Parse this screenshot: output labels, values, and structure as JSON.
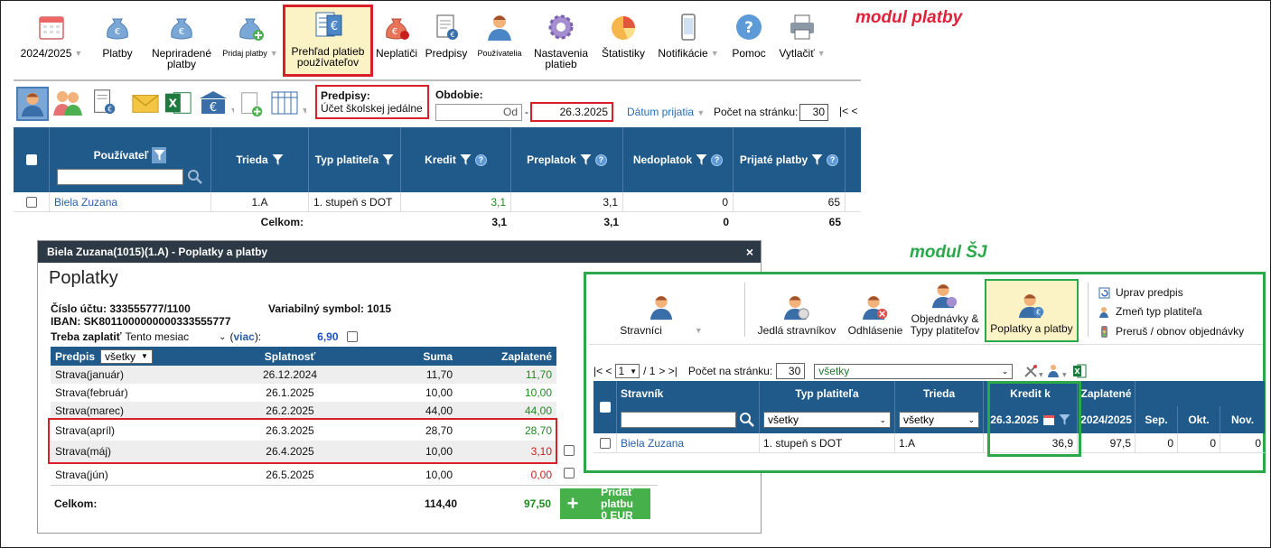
{
  "annotations": {
    "platby": "modul platby",
    "sj": "modul ŠJ"
  },
  "toolbar": {
    "items": [
      {
        "label": "2024/2025",
        "dropdown": true,
        "icon": "calendar-icon"
      },
      {
        "label": "Platby",
        "icon": "money-bag-icon"
      },
      {
        "label": "Nepriradené platby",
        "icon": "money-bag-icon"
      },
      {
        "label": "Pridaj platby",
        "dropdown": true,
        "icon": "money-bag-add-icon"
      },
      {
        "label": "Prehľad platieb používateľov",
        "active": true,
        "icon": "payments-overview-icon"
      },
      {
        "label": "Neplatiči",
        "icon": "money-bag-warning-icon"
      },
      {
        "label": "Predpisy",
        "icon": "document-euro-icon"
      },
      {
        "label": "Používatelia",
        "icon": "user-icon"
      },
      {
        "label": "Nastavenia platieb",
        "icon": "gear-icon"
      },
      {
        "label": "Štatistiky",
        "icon": "pie-chart-icon"
      },
      {
        "label": "Notifikácie",
        "dropdown": true,
        "icon": "phone-icon"
      },
      {
        "label": "Pomoc",
        "icon": "help-icon"
      },
      {
        "label": "Vytlačiť",
        "dropdown": true,
        "icon": "printer-icon"
      }
    ]
  },
  "filters": {
    "predpisy_label": "Predpisy:",
    "predpisy_value": "Účet školskej jedálne",
    "obdobie_label": "Obdobie:",
    "od_placeholder": "Od",
    "dash": "-",
    "do_value": "26.3.2025",
    "datum_prijatia": "Dátum prijatia",
    "pocet_label": "Počet na stránku:",
    "pocet_value": "30",
    "pager": "|<  <"
  },
  "top_table": {
    "headers": [
      "Používateľ",
      "Trieda",
      "Typ platiteľa",
      "Kredit",
      "Preplatok",
      "Nedoplatok",
      "Prijaté platby"
    ],
    "rows": [
      {
        "pouzivatel": "Biela Zuzana",
        "trieda": "1.A",
        "typ": "1. stupeň  s DOT",
        "kredit": "3,1",
        "preplatok": "3,1",
        "nedoplatok": "0",
        "prijate": "65"
      }
    ],
    "total": {
      "label": "Celkom:",
      "kredit": "3,1",
      "preplatok": "3,1",
      "nedoplatok": "0",
      "prijate": "65"
    }
  },
  "modal": {
    "title": "Biela Zuzana(1015)(1.A) - Poplatky a platby",
    "close": "×",
    "heading": "Poplatky",
    "cislo_uctu": "Číslo účtu: 333555777/1100",
    "variabilny": "Variabilný symbol: 1015",
    "iban": "IBAN: SK8011000000000333555777",
    "treba_label": "Treba zaplatiť",
    "treba_option": "Tento mesiac",
    "viac_open": "(",
    "viac": "viac",
    "viac_close": "):",
    "treba_amount": "6,90",
    "headers": {
      "predpis": "Predpis",
      "filter": "všetky",
      "splatnost": "Splatnosť",
      "suma": "Suma",
      "zaplatene": "Zaplatené"
    },
    "rows": [
      {
        "predpis": "Strava(január)",
        "splatnost": "26.12.2024",
        "suma": "11,70",
        "zaplatene": "11,70",
        "color": "green"
      },
      {
        "predpis": "Strava(február)",
        "splatnost": "26.1.2025",
        "suma": "10,00",
        "zaplatene": "10,00",
        "color": "green"
      },
      {
        "predpis": "Strava(marec)",
        "splatnost": "26.2.2025",
        "suma": "44,00",
        "zaplatene": "44,00",
        "color": "green"
      },
      {
        "predpis": "Strava(apríl)",
        "splatnost": "26.3.2025",
        "suma": "28,70",
        "zaplatene": "28,70",
        "color": "green"
      },
      {
        "predpis": "Strava(máj)",
        "splatnost": "26.4.2025",
        "suma": "10,00",
        "zaplatene": "3,10",
        "color": "red"
      },
      {
        "predpis": "Strava(jún)",
        "splatnost": "26.5.2025",
        "suma": "10,00",
        "zaplatene": "0,00",
        "color": "red"
      }
    ],
    "total_label": "Celkom:",
    "total_suma": "114,40",
    "total_zaplatene": "97,50",
    "add_button_line1": "Pridať platbu",
    "add_button_line2": "0 EUR"
  },
  "sj": {
    "toolbar": {
      "stravnici": "Stravníci",
      "jedla": "Jedlá stravníkov",
      "odhlasenie": "Odhlásenie",
      "objednavky": "Objednávky & Typy platiteľov",
      "poplatky": "Poplatky a platby",
      "uprav": "Uprav predpis",
      "zmen": "Zmeň typ platiteľa",
      "prerus": "Preruš / obnov objednávky"
    },
    "pager": {
      "first": "|<  <",
      "page": "1",
      "of": "/ 1",
      "next": ">  >|",
      "pocet_label": "Počet na stránku:",
      "pocet_value": "30",
      "filter": "všetky"
    },
    "headers": {
      "stravnik": "Stravník",
      "typ": "Typ platiteľa",
      "trieda": "Trieda",
      "kredit": "Kredit k",
      "kredit_date": "26.3.2025",
      "zaplatene": "Zaplatené",
      "zaplatene_year": "2024/2025",
      "sep": "Sep.",
      "okt": "Okt.",
      "nov": "Nov.",
      "typ_filter": "všetky",
      "trieda_filter": "všetky"
    },
    "row": {
      "stravnik": "Biela Zuzana",
      "typ": "1. stupeň  s DOT",
      "trieda": "1.A",
      "kredit": "36,9",
      "zaplatene": "97,5",
      "sep": "0",
      "okt": "0",
      "nov": "0"
    }
  },
  "colors": {
    "header_blue": "#1f5a8a",
    "highlight_red": "#d8202a",
    "highlight_green": "#2aa84a",
    "active_bg": "#fbf3c5"
  }
}
